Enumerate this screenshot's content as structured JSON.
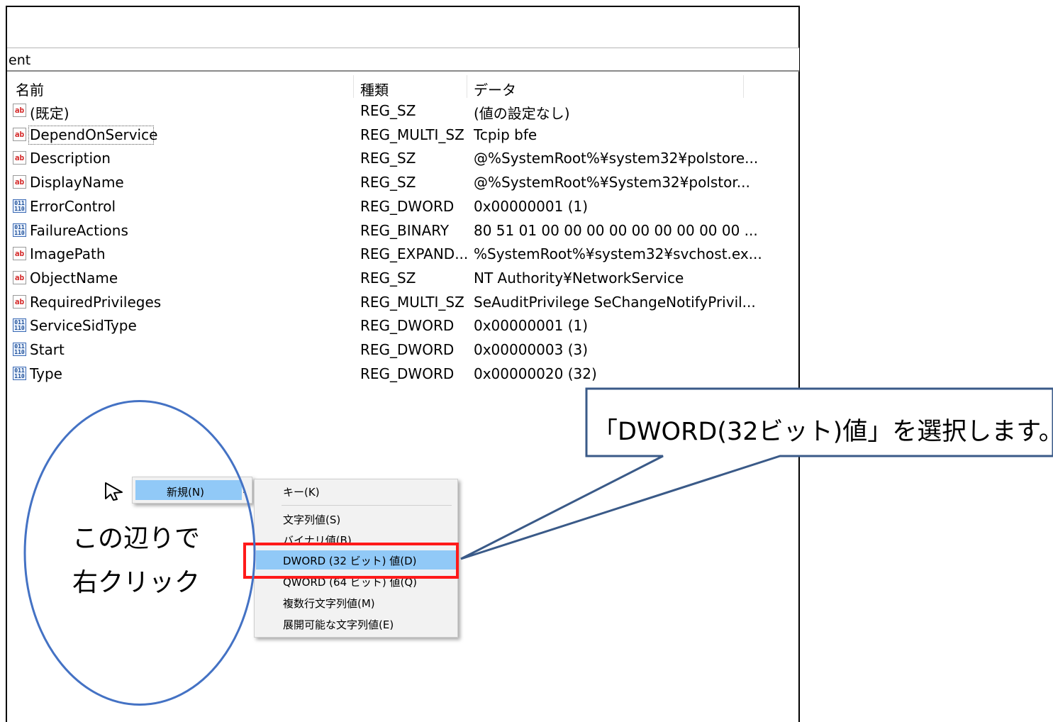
{
  "path": {
    "text": "ent"
  },
  "columns": {
    "name": "名前",
    "type": "種類",
    "data": "データ"
  },
  "rows": [
    {
      "icon": "ab-string-icon",
      "name": "(既定)",
      "type": "REG_SZ",
      "data": "(値の設定なし)"
    },
    {
      "icon": "ab-string-icon",
      "name": "DependOnService",
      "type": "REG_MULTI_SZ",
      "data": "Tcpip bfe"
    },
    {
      "icon": "ab-string-icon",
      "name": "Description",
      "type": "REG_SZ",
      "data": "@%SystemRoot%¥system32¥polstore..."
    },
    {
      "icon": "ab-string-icon",
      "name": "DisplayName",
      "type": "REG_SZ",
      "data": "@%SystemRoot%¥System32¥polstor..."
    },
    {
      "icon": "binary-value-icon",
      "name": "ErrorControl",
      "type": "REG_DWORD",
      "data": "0x00000001 (1)"
    },
    {
      "icon": "binary-value-icon",
      "name": "FailureActions",
      "type": "REG_BINARY",
      "data": "80 51 01 00 00 00 00 00 00 00 00 00 ..."
    },
    {
      "icon": "ab-string-icon",
      "name": "ImagePath",
      "type": "REG_EXPAND...",
      "data": "%SystemRoot%¥system32¥svchost.ex..."
    },
    {
      "icon": "ab-string-icon",
      "name": "ObjectName",
      "type": "REG_SZ",
      "data": "NT Authority¥NetworkService"
    },
    {
      "icon": "ab-string-icon",
      "name": "RequiredPrivileges",
      "type": "REG_MULTI_SZ",
      "data": "SeAuditPrivilege SeChangeNotifyPrivil..."
    },
    {
      "icon": "binary-value-icon",
      "name": "ServiceSidType",
      "type": "REG_DWORD",
      "data": "0x00000001 (1)"
    },
    {
      "icon": "binary-value-icon",
      "name": "Start",
      "type": "REG_DWORD",
      "data": "0x00000003 (3)"
    },
    {
      "icon": "binary-value-icon",
      "name": "Type",
      "type": "REG_DWORD",
      "data": "0x00000020 (32)"
    }
  ],
  "context_menu": {
    "new_label": "新規(N)"
  },
  "submenu": {
    "key": "キー(K)",
    "string": "文字列値(S)",
    "binary": "バイナリ値(B)",
    "dword": "DWORD (32 ビット) 値(D)",
    "qword": "QWORD (64 ビット) 値(Q)",
    "multi_string": "複数行文字列値(M)",
    "expand_string": "展開可能な文字列値(E)"
  },
  "annotation": {
    "right_click_line1": "この辺りで",
    "right_click_line2": "右クリック",
    "callout": "「DWORD(32ビット)値」を選択します。"
  },
  "colors": {
    "highlight": "#91c9f7",
    "red_box": "#ff1a1a",
    "callout_border": "#3a5a88",
    "ellipse": "#4472c4"
  }
}
